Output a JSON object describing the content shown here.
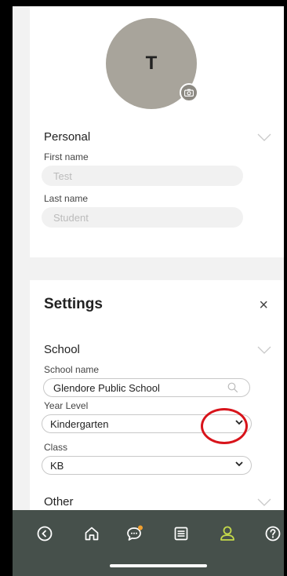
{
  "profile": {
    "avatar_initial": "T"
  },
  "personal": {
    "title": "Personal",
    "first_name_label": "First name",
    "first_name_value": "Test",
    "last_name_label": "Last name",
    "last_name_value": "Student"
  },
  "settings": {
    "title": "Settings",
    "close_label": "×",
    "school": {
      "title": "School",
      "school_name_label": "School name",
      "school_name_value": "Glendore Public School",
      "year_level_label": "Year Level",
      "year_level_value": "Kindergarten",
      "class_label": "Class",
      "class_value": "KB"
    },
    "other": {
      "title": "Other"
    }
  },
  "nav": {
    "items": [
      {
        "icon": "back-circle-icon"
      },
      {
        "icon": "home-icon"
      },
      {
        "icon": "chat-icon",
        "has_notification": true
      },
      {
        "icon": "list-icon"
      },
      {
        "icon": "profile-icon",
        "active": true
      },
      {
        "icon": "help-icon"
      }
    ]
  },
  "colors": {
    "nav_background": "#46504b",
    "nav_icon": "#ffffff",
    "nav_active": "#c4d94a",
    "notification_dot": "#f0a030",
    "avatar_background": "#a8a49b",
    "highlight_ring": "#d8141b"
  }
}
